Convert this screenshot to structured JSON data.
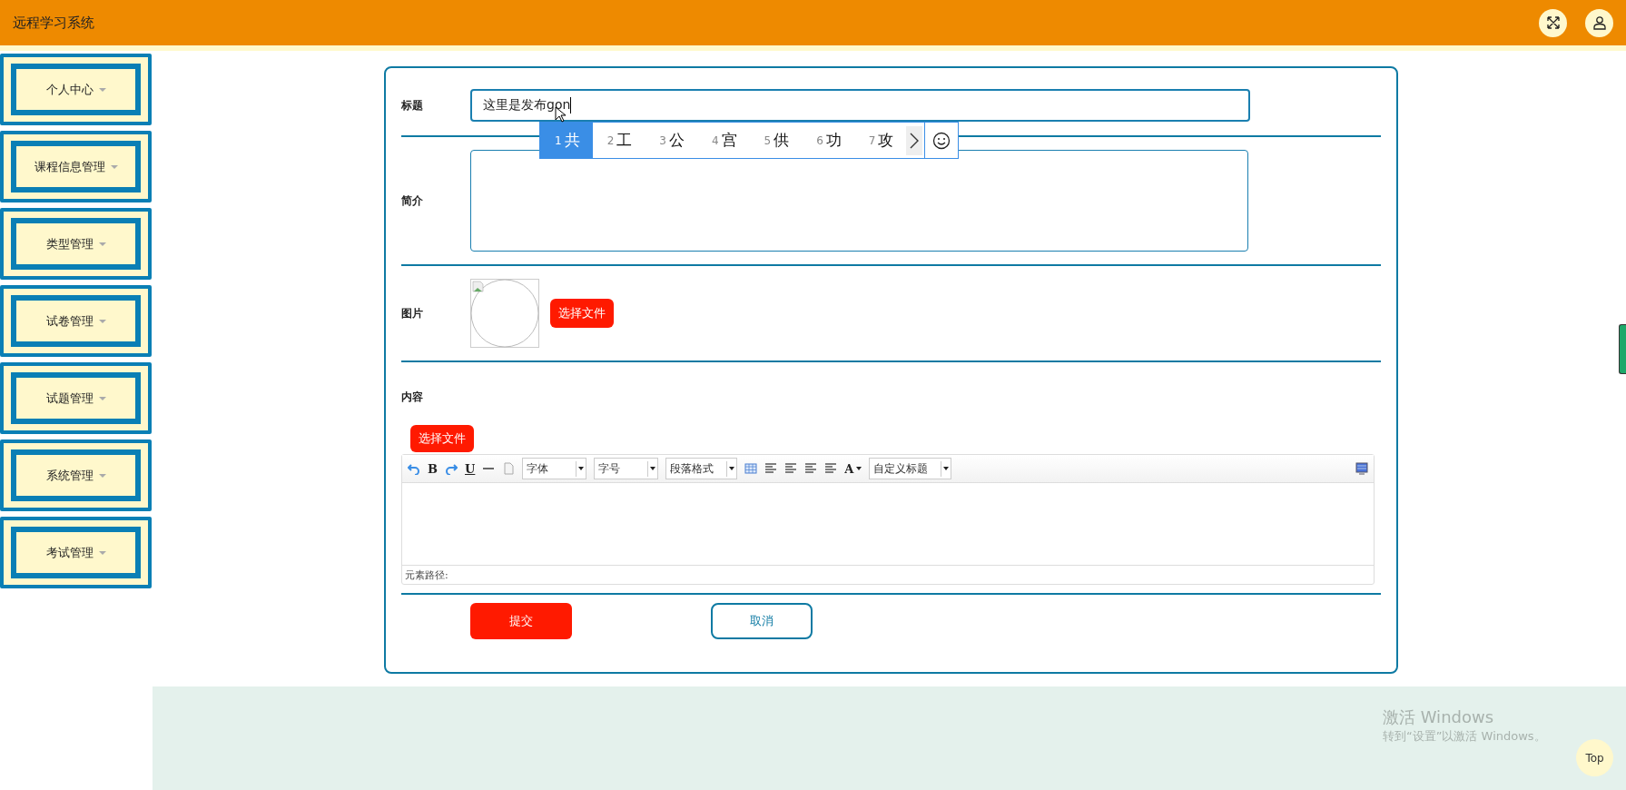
{
  "header": {
    "title": "远程学习系统"
  },
  "sidebar": {
    "items": [
      {
        "label": "个人中心"
      },
      {
        "label": "课程信息管理"
      },
      {
        "label": "类型管理"
      },
      {
        "label": "试卷管理"
      },
      {
        "label": "试题管理"
      },
      {
        "label": "系统管理"
      },
      {
        "label": "考试管理"
      }
    ]
  },
  "form": {
    "title": {
      "label": "标题",
      "value": "这里是发布gon"
    },
    "intro": {
      "label": "简介"
    },
    "picture": {
      "label": "图片",
      "button": "选择文件"
    },
    "content": {
      "label": "内容",
      "button": "选择文件",
      "toolbar": [
        {
          "kind": "undo"
        },
        {
          "kind": "glyph",
          "text": "B"
        },
        {
          "kind": "redo"
        },
        {
          "kind": "glyph",
          "text": "U",
          "underline": true
        },
        {
          "kind": "hr"
        },
        {
          "kind": "page"
        },
        {
          "kind": "select",
          "text": "字体"
        },
        {
          "kind": "select",
          "text": "字号"
        },
        {
          "kind": "select",
          "text": "段落格式"
        },
        {
          "kind": "table"
        },
        {
          "kind": "align"
        },
        {
          "kind": "align"
        },
        {
          "kind": "align"
        },
        {
          "kind": "align"
        },
        {
          "kind": "color",
          "text": "A"
        },
        {
          "kind": "select",
          "text": "自定义标题"
        }
      ],
      "footer": "元素路径:"
    },
    "submit": "提交",
    "cancel": "取消"
  },
  "ime": {
    "candidates": [
      {
        "index": "1",
        "text": "共",
        "selected": true
      },
      {
        "index": "2",
        "text": "工",
        "selected": false
      },
      {
        "index": "3",
        "text": "公",
        "selected": false
      },
      {
        "index": "4",
        "text": "宫",
        "selected": false
      },
      {
        "index": "5",
        "text": "供",
        "selected": false
      },
      {
        "index": "6",
        "text": "功",
        "selected": false
      },
      {
        "index": "7",
        "text": "攻",
        "selected": false
      }
    ]
  },
  "os_notice": {
    "heading": "激活 Windows",
    "text": "转到“设置”以激活 Windows。"
  },
  "top_button": "Top"
}
